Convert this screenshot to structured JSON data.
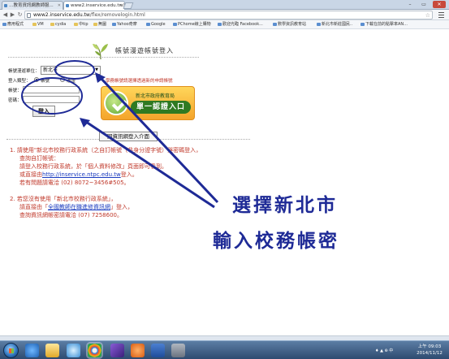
{
  "browser": {
    "tabs": [
      {
        "label": "…教育資訊網教師服..."
      },
      {
        "label": "www2.inservice.edu.tw/"
      }
    ],
    "url_host": "www2.inservice.edu.tw",
    "url_path": "/flex/removelogin.html",
    "bookmarks": [
      "應用程式",
      "VM",
      "cydia",
      "中tip",
      "無圖",
      "Yahoo奇摩",
      "Google",
      "PChome線上購物",
      "歡迎光臨 Facebook...",
      "數學資訊教育站",
      "新北市新莊國民..",
      "下載在前的點擊率AN..."
    ]
  },
  "page": {
    "title": "帳號漫遊帳號登入",
    "region_label": "帳號漫遊單位：",
    "region_value": "新北市",
    "login_type_label": "登入類型：",
    "radio_1": "帳號",
    "radio_2": "憑證",
    "notice": "學務帳號請選擇透過新的申請帳號",
    "account_label": "帳號：",
    "password_label": "密碼：",
    "login_button": "登入",
    "banner_sub": "新北市政府教育局",
    "banner_main": "單一認證入口",
    "back_button": "回資訊網登入介面",
    "note1": {
      "line1": "1. 請使用\"新北市校務行政系統（之自訂帳號（非身分證字號）與密碼登入，",
      "line2": "查詢自訂帳號：",
      "line3": "請登入校務行政系統，於「個人資料修改」頁面即可看到。",
      "line4_prefix": "或直接由",
      "line4_link": "http://inservice.ntpc.edu.tw",
      "line4_suffix": "登入。",
      "line5": "若有問題請電洽 (02) 8072~3456#505。"
    },
    "note2": {
      "line1": "2. 若您沒有使用「新北市校務行政系統」，",
      "line2_prefix": "請直接由「",
      "line2_link": "全國教師在職進修資訊網",
      "line2_suffix": "」登入，",
      "line3": "查詢資訊網帳密請電洽 (07) 7258600。"
    }
  },
  "overlay": {
    "line1": "選擇新北市",
    "line2": "輸入校務帳密",
    "color": "#1e2a96"
  },
  "taskbar": {
    "tray": "♦ ▲ ⊕ 中",
    "time": "上午 09:03",
    "date": "2014/11/12"
  }
}
